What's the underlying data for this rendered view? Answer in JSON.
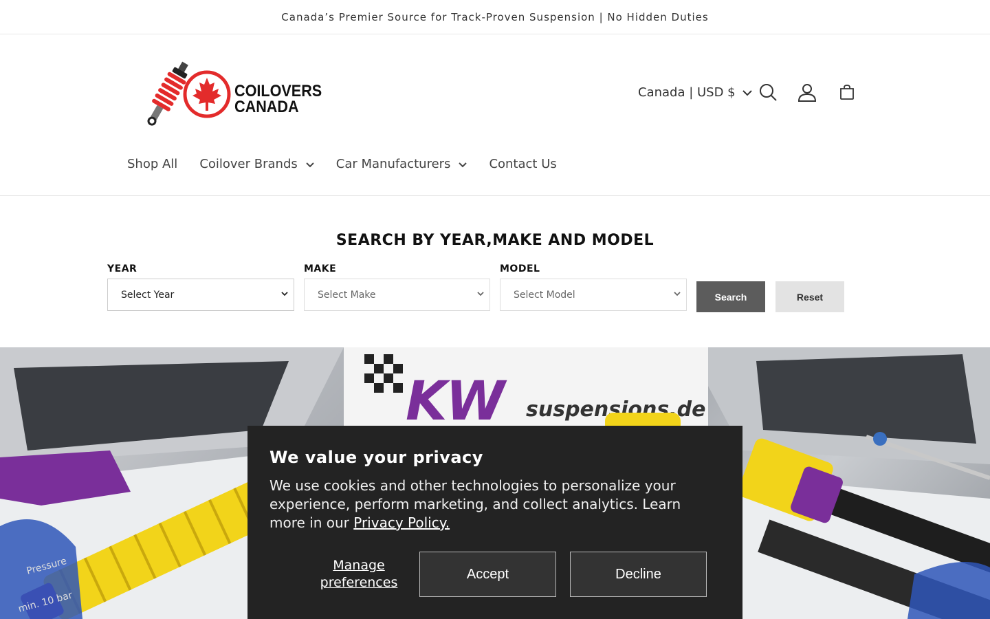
{
  "announcement": {
    "text": "Canada’s Premier Source for Track-Proven Suspension | No Hidden Duties"
  },
  "header": {
    "logo": {
      "line1": "COILOVERS",
      "line2": "CANADA"
    },
    "localization": "Canada | USD $",
    "icons": [
      "search-icon",
      "account-icon",
      "cart-icon"
    ]
  },
  "nav": {
    "items": [
      {
        "label": "Shop All",
        "has_dropdown": false
      },
      {
        "label": "Coilover Brands",
        "has_dropdown": true
      },
      {
        "label": "Car Manufacturers",
        "has_dropdown": true
      },
      {
        "label": "Contact Us",
        "has_dropdown": false
      }
    ]
  },
  "search": {
    "title": "SEARCH BY YEAR,MAKE AND MODEL",
    "year": {
      "label": "YEAR",
      "value": "Select Year"
    },
    "make": {
      "label": "MAKE",
      "value": "Select Make"
    },
    "model": {
      "label": "MODEL",
      "value": "Select Model"
    },
    "search_label": "Search",
    "reset_label": "Reset"
  },
  "hero": {
    "sign_brand": "KW",
    "sign_site": "suspensions.de",
    "tag_line1": "Pressure",
    "tag_line2": "min. 10 bar"
  },
  "cookie": {
    "title": "We value your privacy",
    "text": "We use cookies and other technologies to personalize your experience, perform marketing, and collect analytics. Learn more in our ",
    "link": "Privacy Policy.",
    "manage_label": "Manage preferences",
    "accept_label": "Accept",
    "decline_label": "Decline"
  },
  "colors": {
    "accent_red": "#e32b2b",
    "spring_yellow": "#f2d41a",
    "kw_purple": "#7a2f9a",
    "banner_dark": "#232323"
  }
}
